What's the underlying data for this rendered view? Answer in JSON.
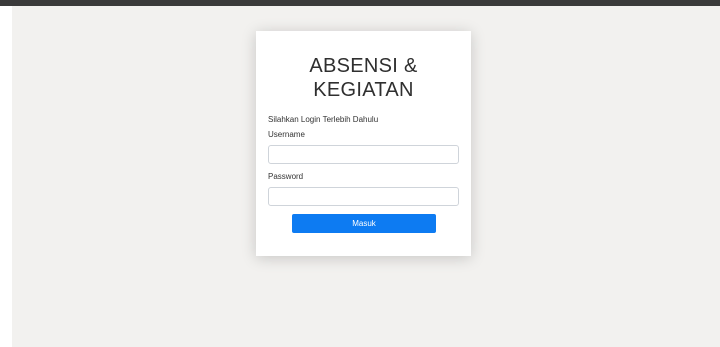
{
  "login": {
    "title_line1": "ABSENSI &",
    "title_line2": "KEGIATAN",
    "subtitle": "Silahkan Login Terlebih Dahulu",
    "username_label": "Username",
    "username_value": "",
    "password_label": "Password",
    "password_value": "",
    "submit_label": "Masuk"
  },
  "colors": {
    "top_bar": "#3a3a3a",
    "page_background": "#f2f1ef",
    "card_background": "#ffffff",
    "button": "#0d7bf2"
  }
}
